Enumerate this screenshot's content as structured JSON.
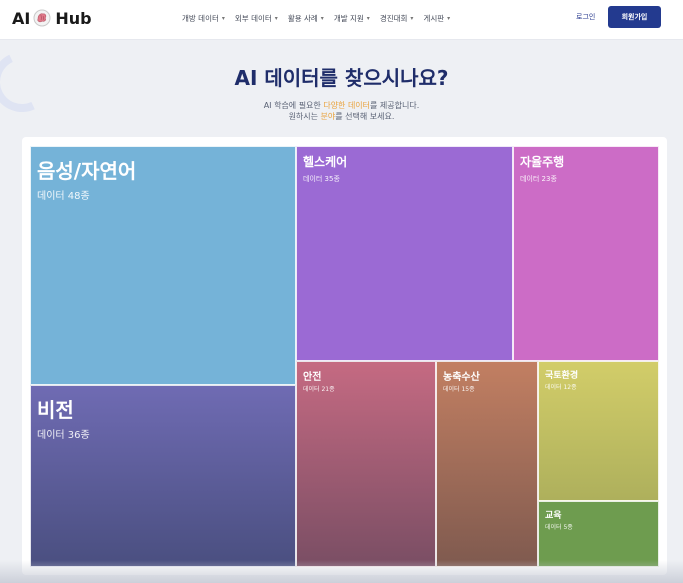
{
  "logo": {
    "part1": "AI",
    "part2": "Hub",
    "icon": "brain-icon"
  },
  "nav": [
    {
      "label": "개방 데이터"
    },
    {
      "label": "외부 데이터"
    },
    {
      "label": "활용 사례"
    },
    {
      "label": "개발 지원"
    },
    {
      "label": "경진대회"
    },
    {
      "label": "게시판"
    }
  ],
  "auth": {
    "login_label": "로그인",
    "signup_label": "회원가입"
  },
  "hero": {
    "title": "AI 데이터를 찾으시나요?",
    "line1_pre": "AI 학습에 필요한 ",
    "line1_hl": "다양한 데이터",
    "line1_post": "를 제공합니다.",
    "line2_pre": "원하시는 ",
    "line2_hl": "분야",
    "line2_post": "를 선택해 보세요."
  },
  "colors": {
    "brand": "#233a8f",
    "highlight": "#e9a23b",
    "voice": "#75b3d8",
    "vision": "#5b5e9a",
    "health": "#9b6ad4",
    "auto": "#cc6cc6",
    "safety": "#a65e76",
    "agri": "#a66e59",
    "land": "#c4c063",
    "edu": "#6e9c4f"
  },
  "treemap": {
    "voice": {
      "name": "음성/자연어",
      "count": "데이터 48종"
    },
    "vision": {
      "name": "비전",
      "count": "데이터 36종"
    },
    "health": {
      "name": "헬스케어",
      "count": "데이터 35종"
    },
    "auto": {
      "name": "자율주행",
      "count": "데이터 23종"
    },
    "safety": {
      "name": "안전",
      "count": "데이터 21종"
    },
    "agri": {
      "name": "농축수산",
      "count": "데이터 15종"
    },
    "land": {
      "name": "국토환경",
      "count": "데이터 12종"
    },
    "edu": {
      "name": "교육",
      "count": "데이터 5종"
    }
  }
}
